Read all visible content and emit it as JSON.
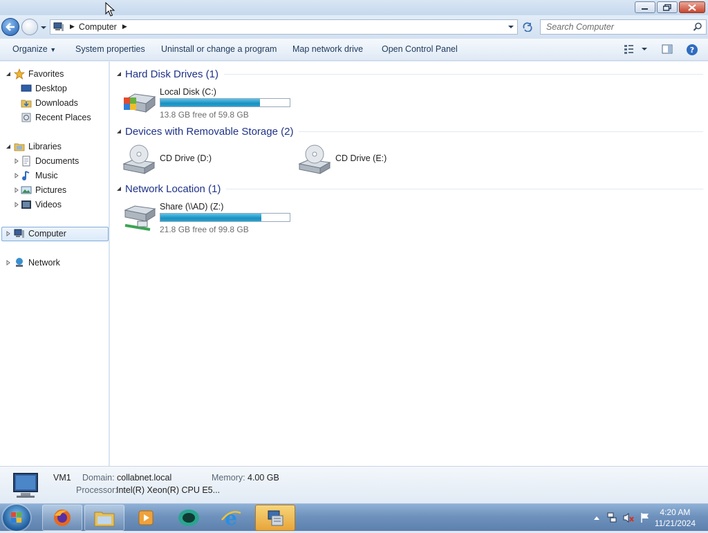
{
  "address_bar": {
    "breadcrumb": "Computer",
    "search_placeholder": "Search Computer"
  },
  "toolbar": {
    "organize": "Organize",
    "system_properties": "System properties",
    "uninstall": "Uninstall or change a program",
    "map_drive": "Map network drive",
    "control_panel": "Open Control Panel"
  },
  "nav": {
    "favorites": "Favorites",
    "desktop": "Desktop",
    "downloads": "Downloads",
    "recent_places": "Recent Places",
    "libraries": "Libraries",
    "documents": "Documents",
    "music": "Music",
    "pictures": "Pictures",
    "videos": "Videos",
    "computer": "Computer",
    "network": "Network"
  },
  "groups": {
    "hard_disks": {
      "title": "Hard Disk Drives (1)",
      "drives": [
        {
          "name": "Local Disk (C:)",
          "free": "13.8 GB free of 59.8 GB",
          "used_fraction": 0.77
        }
      ]
    },
    "removable": {
      "title": "Devices with Removable Storage (2)",
      "drives": [
        {
          "name": "CD Drive (D:)"
        },
        {
          "name": "CD Drive (E:)"
        }
      ]
    },
    "network": {
      "title": "Network Location (1)",
      "drives": [
        {
          "name": "Share (\\\\AD) (Z:)",
          "free": "21.8 GB free of 99.8 GB",
          "used_fraction": 0.78
        }
      ]
    }
  },
  "details": {
    "computer_name": "VM1",
    "domain_label": "Domain:",
    "domain_value": "collabnet.local",
    "memory_label": "Memory:",
    "memory_value": "4.00 GB",
    "processor_label": "Processor:",
    "processor_value": "Intel(R) Xeon(R) CPU E5..."
  },
  "taskbar": {
    "time": "4:20 AM",
    "date": "11/21/2024"
  },
  "colors": {
    "accent": "#1e3287",
    "bar_fill": "#1a8fc0"
  }
}
